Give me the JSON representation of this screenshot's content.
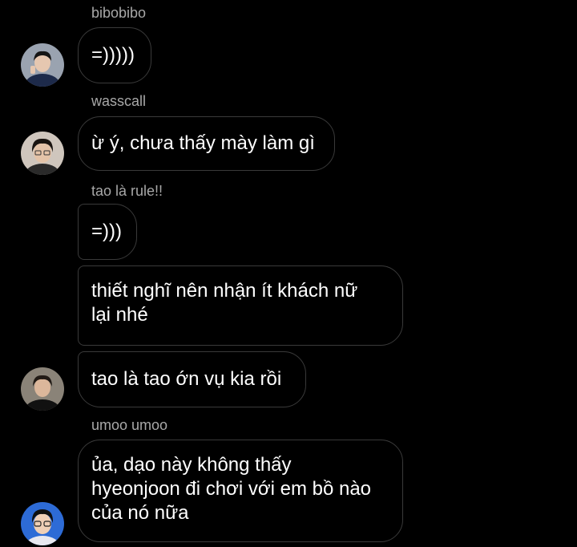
{
  "messages": [
    {
      "sender": "bibobibo",
      "text": "=)))))"
    },
    {
      "sender": "wasscall",
      "text": "ừ ý, chưa thấy mày làm gì"
    },
    {
      "sender": "tao là rule!!",
      "text": "=)))"
    },
    {
      "text": "thiết nghĩ nên nhận ít khách nữ\nlại nhé"
    },
    {
      "text": "tao là tao ớn vụ kia rồi"
    },
    {
      "sender": "umoo umoo",
      "text": "ủa, dạo này không thấy\nhyeonjoon đi chơi với em bồ nào\ncủa nó nữa"
    }
  ],
  "avatars": [
    {
      "icon": "user-avatar-icon",
      "colors": {
        "bg": "#9aa3b0",
        "hair": "#151515",
        "skin": "#e6c7b0",
        "shirt": "#1d2a4a"
      }
    },
    {
      "icon": "user-avatar-icon",
      "colors": {
        "bg": "#cfc6bd",
        "hair": "#1a1410",
        "skin": "#e4c3a8",
        "shirt": "#2a2a2a"
      }
    },
    {
      "icon": "user-avatar-icon",
      "colors": {
        "bg": "#8a8378",
        "hair": "#221b16",
        "skin": "#dcb79b",
        "shirt": "#111111"
      }
    },
    {
      "icon": "user-avatar-icon",
      "colors": {
        "bg": "#2d6bd6",
        "hair": "#101010",
        "skin": "#efcfb6",
        "shirt": "#e8e8f0"
      }
    }
  ],
  "theme": {
    "background": "#000000",
    "bubble_border": "#3a3a3a",
    "sender_color": "#a8a8a8",
    "text_color": "#ffffff"
  }
}
